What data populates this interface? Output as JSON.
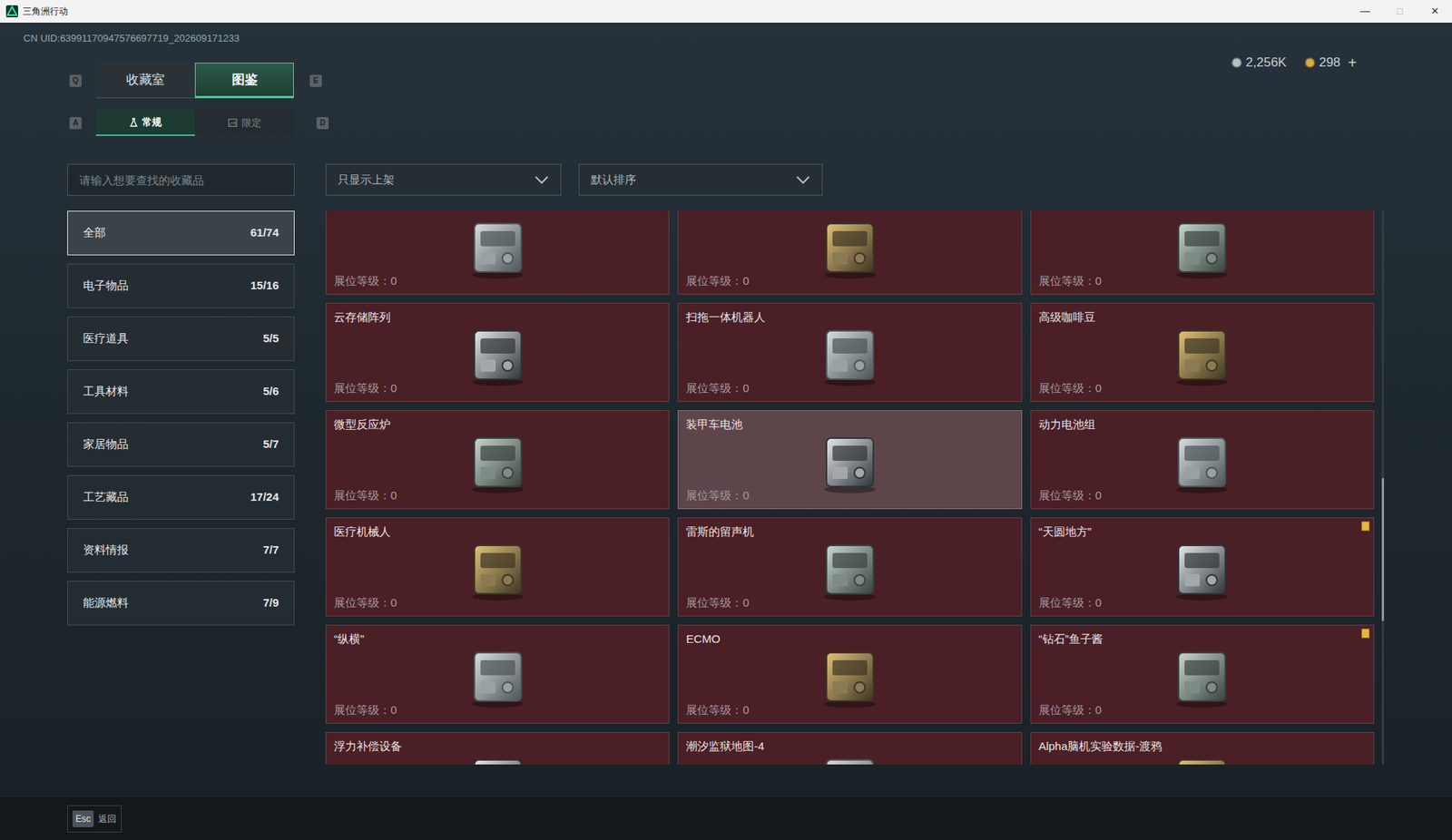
{
  "window": {
    "title": "三角洲行动",
    "controls": [
      "—",
      "□",
      "✕"
    ]
  },
  "uid": "CN UID:63991170947576697719_202609171233",
  "currency": [
    {
      "amount": "2,256K",
      "kind": "silver"
    },
    {
      "amount": "298",
      "kind": "gold"
    }
  ],
  "currency_add": "+",
  "tabs": {
    "prev_key": "Q",
    "next_key": "E",
    "items": [
      {
        "label": "收藏室",
        "selected": false
      },
      {
        "label": "图鉴",
        "selected": true
      }
    ]
  },
  "subtabs": {
    "prev_key": "A",
    "next_key": "D",
    "items": [
      {
        "label": "常规",
        "selected": true
      },
      {
        "label": "限定",
        "selected": false
      }
    ]
  },
  "search": {
    "placeholder": "请输入想要查找的收藏品"
  },
  "filters": [
    {
      "value": "只显示上架"
    },
    {
      "value": "默认排序"
    }
  ],
  "categories": [
    {
      "label": "全部",
      "count": "61/74",
      "selected": true
    },
    {
      "label": "电子物品",
      "count": "15/16",
      "selected": false
    },
    {
      "label": "医疗道具",
      "count": "5/5",
      "selected": false
    },
    {
      "label": "工具材料",
      "count": "5/6",
      "selected": false
    },
    {
      "label": "家居物品",
      "count": "5/7",
      "selected": false
    },
    {
      "label": "工艺藏品",
      "count": "17/24",
      "selected": false
    },
    {
      "label": "资料情报",
      "count": "7/7",
      "selected": false
    },
    {
      "label": "能源燃料",
      "count": "7/9",
      "selected": false
    }
  ],
  "items": [
    {
      "exhibit": "展位等级：0",
      "hovered": false,
      "flagged": false
    },
    {
      "exhibit": "展位等级：0",
      "hovered": false,
      "flagged": false
    },
    {
      "exhibit": "展位等级：0",
      "hovered": false,
      "flagged": false
    },
    {
      "name": "云存储阵列",
      "exhibit": "展位等级：0",
      "hovered": false,
      "flagged": false
    },
    {
      "name": "扫拖一体机器人",
      "exhibit": "展位等级：0",
      "hovered": false,
      "flagged": false
    },
    {
      "name": "高级咖啡豆",
      "exhibit": "展位等级：0",
      "hovered": false,
      "flagged": false
    },
    {
      "name": "微型反应炉",
      "exhibit": "展位等级：0",
      "hovered": false,
      "flagged": false
    },
    {
      "name": "装甲车电池",
      "exhibit": "展位等级：0",
      "hovered": true,
      "flagged": false
    },
    {
      "name": "动力电池组",
      "exhibit": "展位等级：0",
      "hovered": false,
      "flagged": false
    },
    {
      "name": "医疗机械人",
      "exhibit": "展位等级：0",
      "hovered": false,
      "flagged": false
    },
    {
      "name": "雷斯的留声机",
      "exhibit": "展位等级：0",
      "hovered": false,
      "flagged": false
    },
    {
      "name": "“天圆地方”",
      "exhibit": "展位等级：0",
      "hovered": false,
      "flagged": true
    },
    {
      "name": "“纵横”",
      "exhibit": "展位等级：0",
      "hovered": false,
      "flagged": false
    },
    {
      "name": "ECMO",
      "exhibit": "展位等级：0",
      "hovered": false,
      "flagged": false
    },
    {
      "name": "“钻石”鱼子酱",
      "exhibit": "展位等级：0",
      "hovered": false,
      "flagged": true
    },
    {
      "name": "浮力补偿设备",
      "hovered": false,
      "flagged": false
    },
    {
      "name": "潮汐监狱地图-4",
      "hovered": false,
      "flagged": false
    },
    {
      "name": "Alpha脑机实验数据-渡鸦",
      "hovered": false,
      "flagged": false
    }
  ],
  "scrollbar": {
    "level": 0.65
  },
  "footer": {
    "key": "Esc",
    "label": "返回"
  }
}
